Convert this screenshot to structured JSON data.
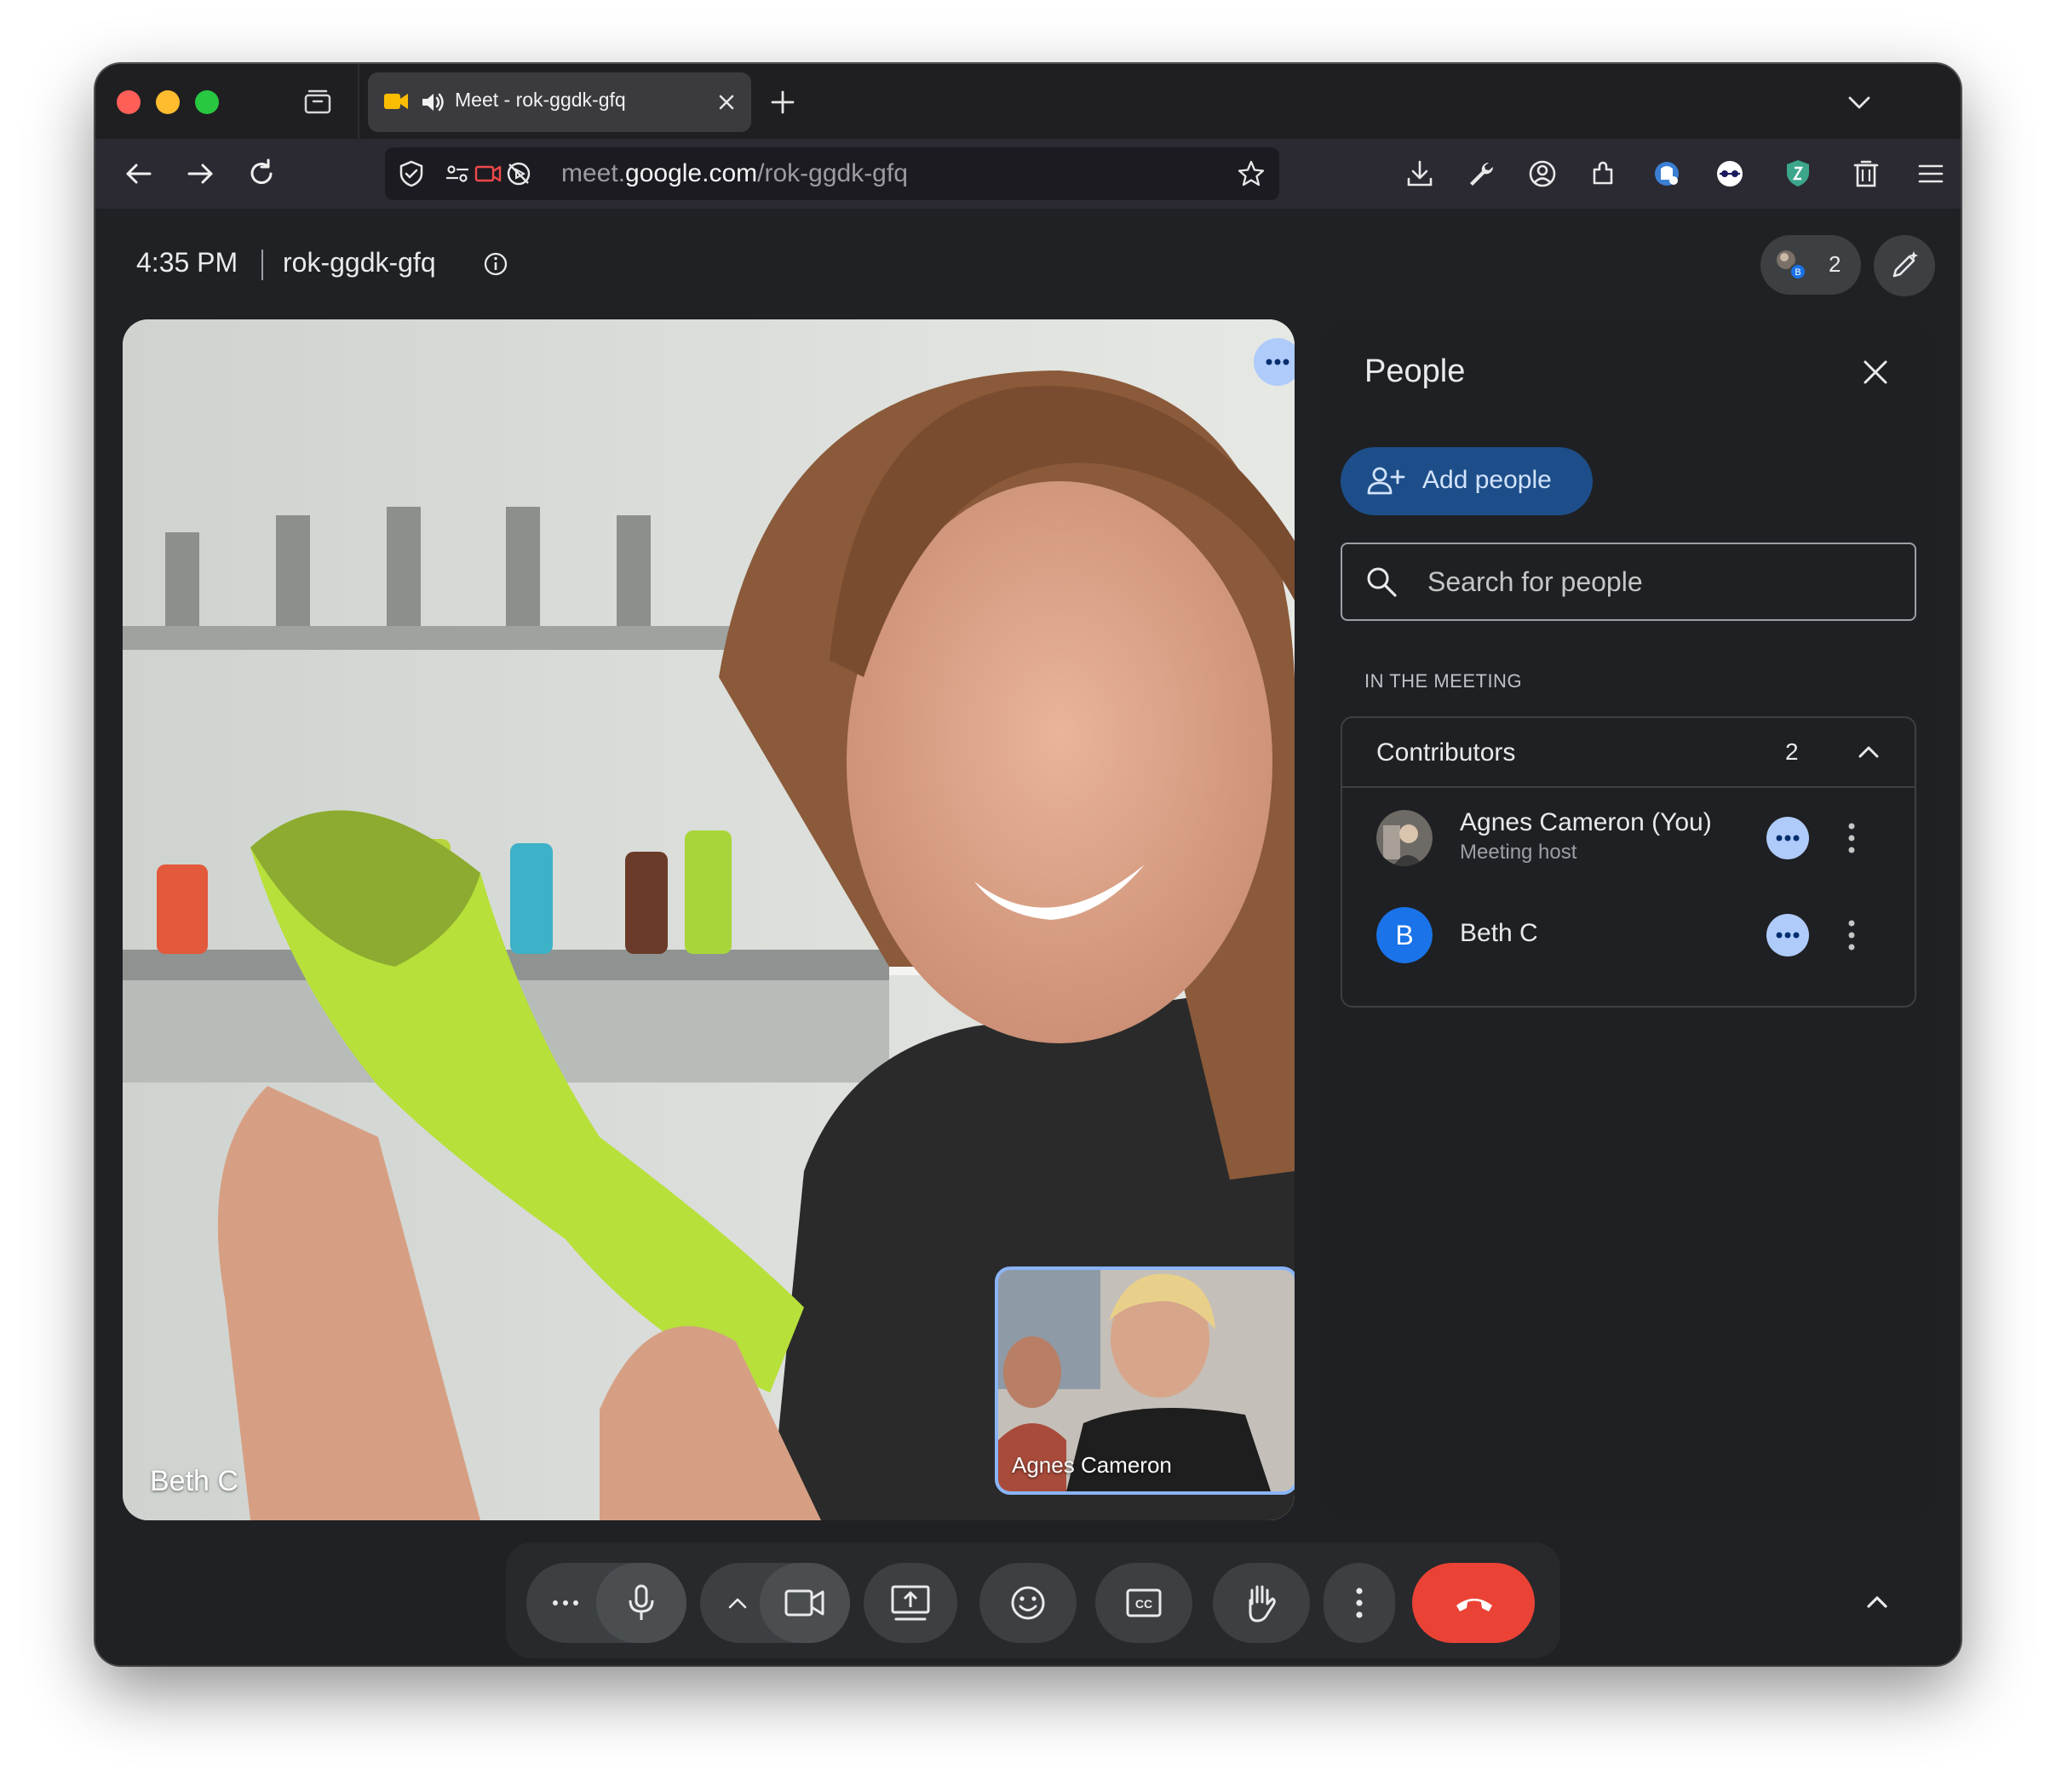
{
  "browser": {
    "tab": {
      "title": "Meet - rok-ggdk-gfq",
      "favicon": "google-meet-icon",
      "audio": "speaker-icon"
    },
    "url": {
      "prefix": "meet.",
      "domain": "google.com",
      "path": "/rok-ggdk-gfq"
    },
    "toolbar_icons": [
      "download-icon",
      "wrench-icon",
      "account-icon",
      "extensions-icon",
      "privacy-badger-icon",
      "eye-extension-icon",
      "shield-extension-icon",
      "trash-icon",
      "menu-icon"
    ]
  },
  "meeting": {
    "time": "4:35 PM",
    "code": "rok-ggdk-gfq",
    "participant_count": "2"
  },
  "video": {
    "main_participant": "Beth C",
    "self_view_name": "Agnes Cameron"
  },
  "people_panel": {
    "title": "People",
    "add_people_label": "Add people",
    "search_placeholder": "Search for people",
    "section_label": "IN THE MEETING",
    "contributors": {
      "title": "Contributors",
      "count": "2",
      "people": [
        {
          "name": "Agnes Cameron (You)",
          "role": "Meeting host"
        },
        {
          "name": "Beth C",
          "initial": "B",
          "avatar_color": "#1a73e8"
        }
      ]
    }
  },
  "controls": [
    "more-options-icon",
    "mic-icon",
    "chevron-up-icon",
    "camera-icon",
    "present-icon",
    "emoji-icon",
    "captions-icon",
    "raise-hand-icon",
    "kebab-icon",
    "hang-up-icon"
  ],
  "colors": {
    "meet_bg": "#202124",
    "accent_blue": "#8ab4f8",
    "hangup_red": "#ea4335",
    "add_button": "#1d4e89"
  }
}
